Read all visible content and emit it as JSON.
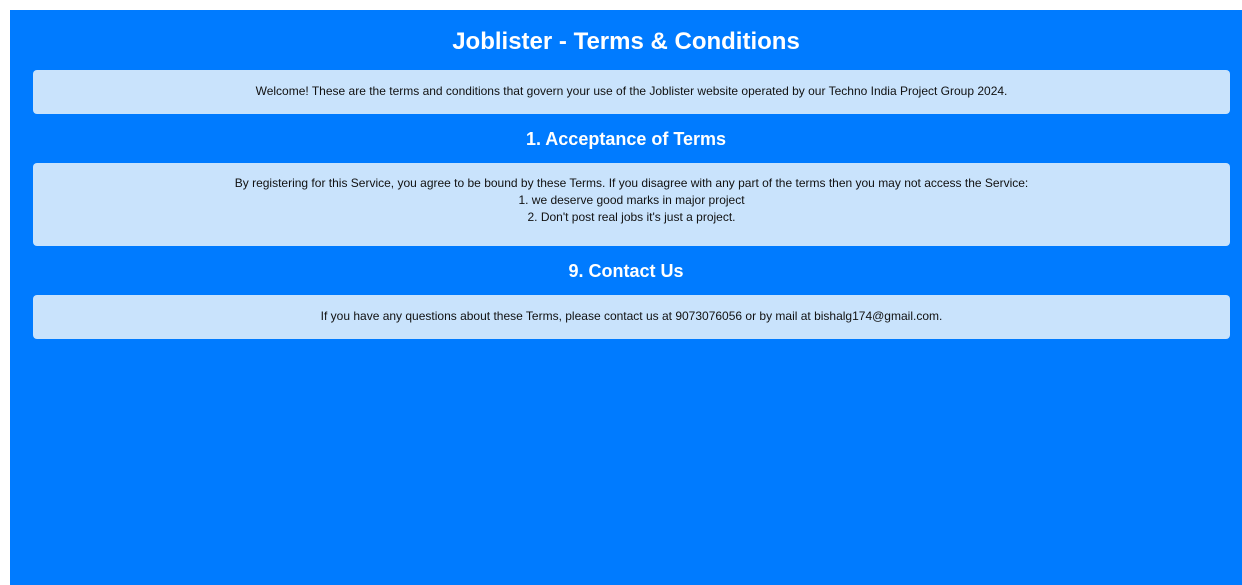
{
  "page": {
    "title": "Joblister - Terms & Conditions",
    "background_color": "#007bff",
    "card_color": "#c9e3fc"
  },
  "intro": {
    "text": "Welcome! These are the terms and conditions that govern your use of the Joblister website operated by our Techno India Project Group 2024."
  },
  "acceptance": {
    "heading": "1. Acceptance of Terms",
    "lines": [
      "By registering for this Service, you agree to be bound by these Terms. If you disagree with any part of the terms then you may not access the Service:",
      "1. we deserve good marks in major project",
      "2. Don't post real jobs it's just a project."
    ]
  },
  "contact": {
    "heading": "9. Contact Us",
    "text": "If you have any questions about these Terms, please contact us at 9073076056 or by mail at bishalg174@gmail.com."
  }
}
